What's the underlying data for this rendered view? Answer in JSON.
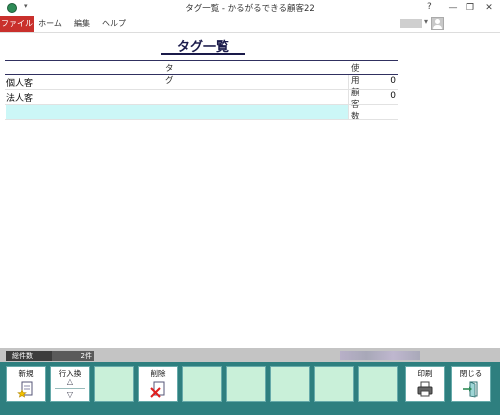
{
  "window": {
    "title": "タグ一覧 - かるがるできる顧客22",
    "help": "?",
    "minimize": "—",
    "restore": "❐",
    "close": "✕",
    "quick_access": "▾",
    "user_dropdown": "▾"
  },
  "ribbon": {
    "tabs": [
      {
        "label": "ファイル",
        "active": true
      },
      {
        "label": "ホーム"
      },
      {
        "label": "編集"
      },
      {
        "label": "ヘルプ"
      }
    ]
  },
  "page": {
    "heading": "タグ一覧"
  },
  "table": {
    "columns": [
      "タグ",
      "使用顧客数"
    ],
    "rows": [
      {
        "tag": "個人客",
        "count": "0"
      },
      {
        "tag": "法人客",
        "count": "0"
      }
    ]
  },
  "status": {
    "total_label": "総件数",
    "total_value": "2件"
  },
  "buttons": {
    "new": {
      "label": "新規",
      "icon": "new-document-icon"
    },
    "row_swap": {
      "label": "行入換",
      "up": "△",
      "down": "▽"
    },
    "delete": {
      "label": "削除",
      "icon": "delete-icon"
    },
    "print": {
      "label": "印刷",
      "icon": "printer-icon"
    },
    "close": {
      "label": "閉じる",
      "icon": "exit-door-icon"
    }
  },
  "colors": {
    "tab_active": "#c9302c",
    "button_bar": "#2e7f7f",
    "new_row_highlight": "#ccf7f7",
    "disabled_button": "#c9f0d9"
  }
}
